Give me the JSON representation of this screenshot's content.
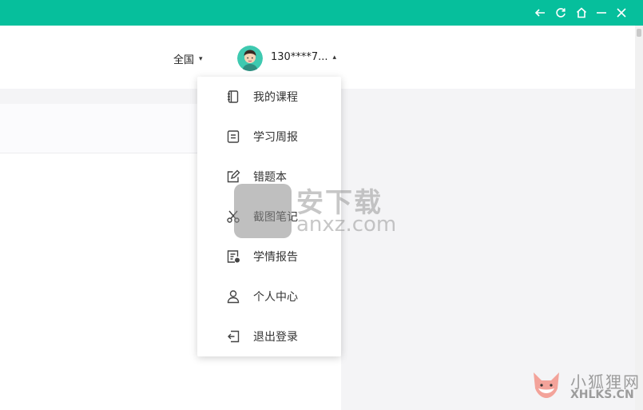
{
  "colors": {
    "titlebar": "#06bf9c",
    "content_gray": "#f4f4f6",
    "menu_text": "#333333"
  },
  "window_controls": [
    {
      "name": "back-icon"
    },
    {
      "name": "refresh-icon"
    },
    {
      "name": "home-icon"
    },
    {
      "name": "minimize-icon"
    },
    {
      "name": "close-icon"
    }
  ],
  "header": {
    "region_label": "全国",
    "region_caret": "▾",
    "username": "130****7...",
    "user_caret": "▴"
  },
  "menu": {
    "items": [
      {
        "label": "我的课程",
        "icon": "notebook-icon"
      },
      {
        "label": "学习周报",
        "icon": "report-icon"
      },
      {
        "label": "错题本",
        "icon": "edit-icon"
      },
      {
        "label": "截图笔记",
        "icon": "scissors-icon"
      },
      {
        "label": "学情报告",
        "icon": "chart-report-icon"
      },
      {
        "label": "个人中心",
        "icon": "user-icon"
      },
      {
        "label": "退出登录",
        "icon": "logout-icon"
      }
    ]
  },
  "watermark": {
    "cn": "安下载",
    "en": "anxz.com"
  },
  "corner_watermark": {
    "cn": "小狐狸网",
    "en": "XHLKS.CN"
  }
}
